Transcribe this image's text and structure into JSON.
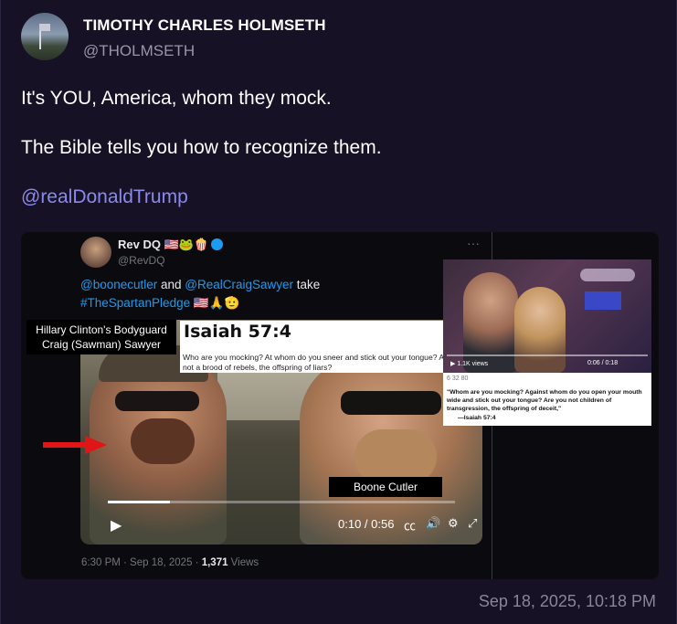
{
  "author": {
    "name": "TIMOTHY CHARLES HOLMSETH",
    "handle": "@THOLMSETH"
  },
  "post": {
    "line1": "It's YOU, America, whom they mock.",
    "line2": "The Bible tells you how to recognize them.",
    "mention": "@realDonaldTrump"
  },
  "embedded_tweet": {
    "name": "Rev DQ 🇺🇸🐸🍿",
    "handle": "@RevDQ",
    "more": "···",
    "mention1": "@boonecutler",
    "and": " and ",
    "mention2": "@RealCraigSawyer",
    "take": " take",
    "hashtag": "#TheSpartanPledge",
    "emoji": " 🇺🇸🙏🫡",
    "video": {
      "time": "0:10 / 0:56",
      "progress": 0.18
    },
    "meta_time": "6:30 PM · Sep 18, 2025 · ",
    "views_count": "1,371",
    "views_label": " Views"
  },
  "overlays": {
    "left_label_line1": "Hillary Clinton's Bodyguard",
    "left_label_line2": "Craig (Sawman) Sawyer",
    "right_label": "Boone Cutler",
    "isaiah_title": "Isaiah 57:4",
    "isaiah_text": "Who are you mocking? At whom do you sneer and stick out your tongue? Are you not a brood of rebels, the offspring of liars?",
    "photo_views": "1.1K views",
    "photo_time": "0:06 / 0:18",
    "quote_icons": "6          32          80",
    "quote_text": "\"Whom are you mocking? Against whom do you open your mouth wide and stick out your tongue? Are you not children of transgression, the offspring of deceit,\"",
    "quote_ref": "—Isaiah 57:4"
  },
  "timestamp": "Sep 18, 2025, 10:18 PM",
  "colors": {
    "background": "#161125",
    "mention": "#8b8aec",
    "link": "#1d9bf0",
    "arrow": "#e01515"
  }
}
